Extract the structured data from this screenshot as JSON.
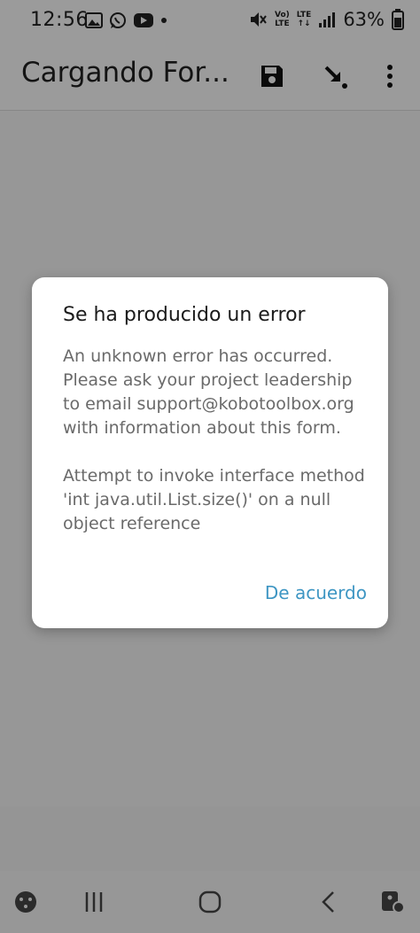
{
  "status_bar": {
    "time": "12:56",
    "network_top": "Vo)",
    "network_bottom": "LTE",
    "lte_top": "LTE",
    "lte_bottom": "↑↓",
    "battery": "63%"
  },
  "app_bar": {
    "title": "Cargando For...",
    "save_icon": "save-icon",
    "jump_icon": "arrow-down-right-icon",
    "menu_icon": "more-vertical-icon"
  },
  "dialog": {
    "title": "Se ha producido un error",
    "message": "An unknown error has occurred. Please ask your project leadership to email support@kobotoolbox.org with information about this form.\n\nAttempt to invoke interface method 'int java.util.List.size()' on a null object reference",
    "action_label": "De acuerdo",
    "action_color": "#3e96c3"
  },
  "nav_bar": {
    "items": [
      "game-launcher-icon",
      "recent-apps-icon",
      "home-icon",
      "back-icon",
      "accessibility-icon"
    ]
  }
}
